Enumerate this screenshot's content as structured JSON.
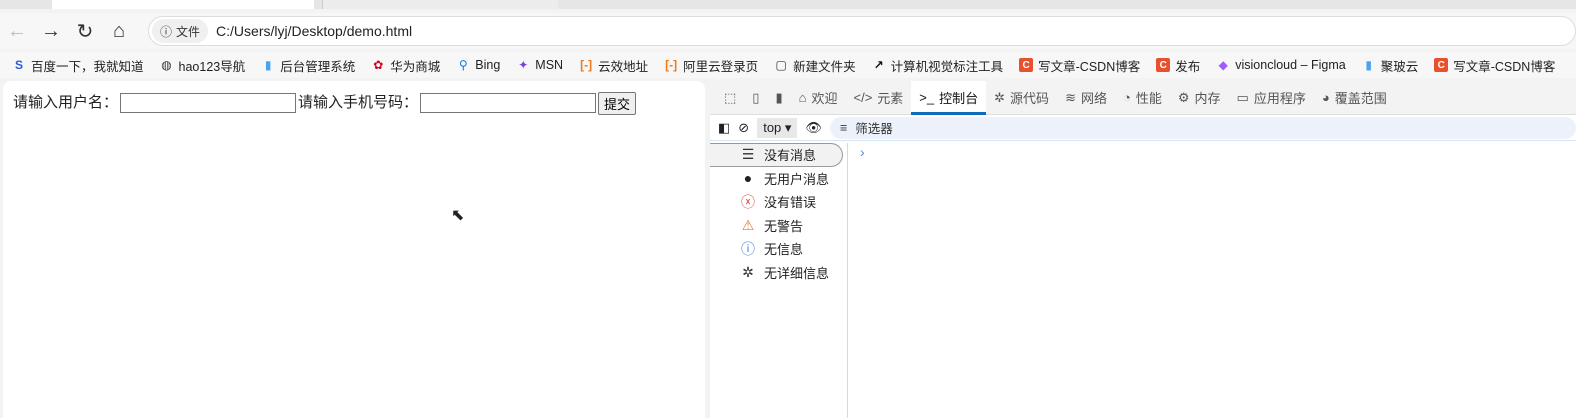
{
  "browser": {
    "nav": {
      "back": "←",
      "forward": "→",
      "reload": "↻",
      "home": "⌂"
    },
    "address": {
      "chip": "文件",
      "url": "C:/Users/lyj/Desktop/demo.html"
    },
    "bookmarks": [
      {
        "label": "百度一下，我就知道",
        "icon": "S",
        "color": "#2a5bd7"
      },
      {
        "label": "hao123导航",
        "icon": "◍",
        "color": "#333"
      },
      {
        "label": "后台管理系统",
        "icon": "▮",
        "color": "#4aa3f0"
      },
      {
        "label": "华为商城",
        "icon": "✿",
        "color": "#d0021b"
      },
      {
        "label": "Bing",
        "icon": "⚲",
        "color": "#1a73e8"
      },
      {
        "label": "MSN",
        "icon": "✦",
        "color": "#7b3fe4"
      },
      {
        "label": "云效地址",
        "icon": "[-]",
        "color": "#f07a1a"
      },
      {
        "label": "阿里云登录页",
        "icon": "[-]",
        "color": "#f07a1a"
      },
      {
        "label": "新建文件夹",
        "icon": "▢",
        "color": "#333"
      },
      {
        "label": "计算机视觉标注工具",
        "icon": "↗",
        "color": "#111"
      },
      {
        "label": "写文章-CSDN博客",
        "icon": "C",
        "color": "#e8512d"
      },
      {
        "label": "发布",
        "icon": "C",
        "color": "#e8512d"
      },
      {
        "label": "visioncloud – Figma",
        "icon": "◆",
        "color": "#a259ff"
      },
      {
        "label": "聚玻云",
        "icon": "▮",
        "color": "#4aa3f0"
      },
      {
        "label": "写文章-CSDN博客",
        "icon": "C",
        "color": "#e8512d"
      }
    ]
  },
  "page": {
    "username_label": "请输入用户名：",
    "phone_label": "请输入手机号码：",
    "submit": "提交"
  },
  "devtools": {
    "tabs": [
      {
        "label": "欢迎",
        "icon": "⌂"
      },
      {
        "label": "元素",
        "icon": "</>"
      },
      {
        "label": "控制台",
        "icon": ">_"
      },
      {
        "label": "源代码",
        "icon": "✲"
      },
      {
        "label": "网络",
        "icon": "≋"
      },
      {
        "label": "性能",
        "icon": "◔"
      },
      {
        "label": "内存",
        "icon": "⚙"
      },
      {
        "label": "应用程序",
        "icon": "▭"
      },
      {
        "label": "覆盖范围",
        "icon": "◕"
      }
    ],
    "active_tab": "控制台",
    "context": "top",
    "filter_placeholder": "筛选器",
    "sidebar": [
      {
        "label": "没有消息",
        "icon": "☰",
        "color": "#333"
      },
      {
        "label": "无用户消息",
        "icon": "●",
        "color": "#222"
      },
      {
        "label": "没有错误",
        "icon": "ⓧ",
        "color": "#d9483b"
      },
      {
        "label": "无警告",
        "icon": "⚠",
        "color": "#e07a3a"
      },
      {
        "label": "无信息",
        "icon": "ⓘ",
        "color": "#3a7bd5"
      },
      {
        "label": "无详细信息",
        "icon": "✲",
        "color": "#333"
      }
    ],
    "prompt": "›"
  }
}
